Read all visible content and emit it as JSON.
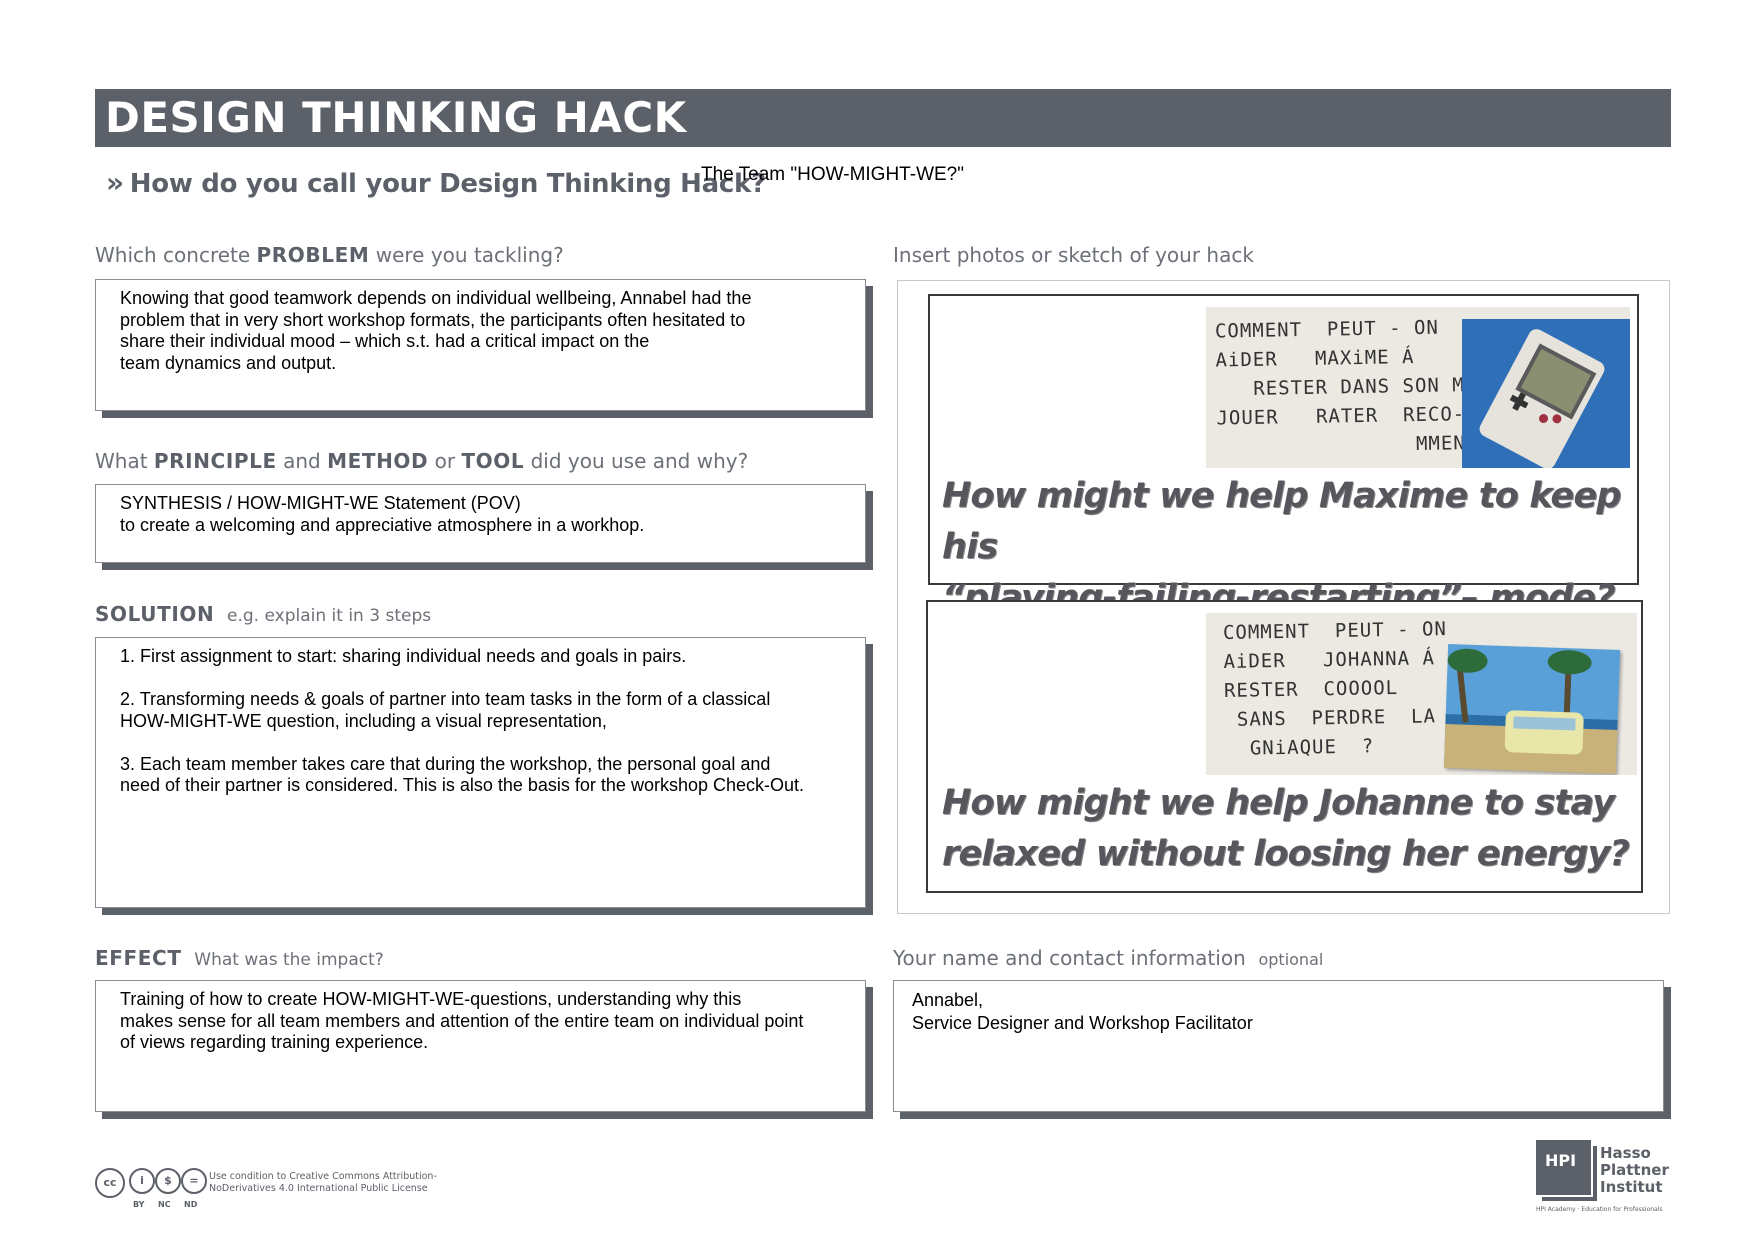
{
  "header": {
    "title": "DESIGN THINKING HACK",
    "hack_question": "How do you call your Design Thinking Hack?",
    "hack_answer": "The Team \"HOW-MIGHT-WE?\""
  },
  "problem": {
    "label_pre": "Which concrete ",
    "label_bold": "PROBLEM",
    "label_post": " were you tackling?",
    "text": "Knowing that good teamwork depends on individual wellbeing, Annabel had the\nproblem that in very short workshop formats, the participants often hesitated to\nshare their individual mood – which s.t. had a critical  impact on the\nteam dynamics and output."
  },
  "principle": {
    "label_pre": "What ",
    "label_b1": "PRINCIPLE",
    "label_and": " and ",
    "label_b2": "METHOD",
    "label_or": " or ",
    "label_b3": "TOOL",
    "label_post": " did you use and why?",
    "text": "SYNTHESIS / HOW-MIGHT-WE Statement (POV)\nto create a welcoming and appreciative atmosphere in a workhop."
  },
  "solution": {
    "label_bold": "SOLUTION",
    "label_post": "e.g. explain it in 3 steps",
    "text": "1. First assignment to start: sharing individual needs and goals in pairs.\n\n2. Transforming needs & goals of partner into team tasks in the form of a classical\nHOW-MIGHT-WE question,  including a visual representation,\n\n3. Each team member takes care that during the workshop, the personal goal and\nneed of their partner is considered. This is also the basis for the workshop Check-Out."
  },
  "effect": {
    "label_bold": "EFFECT",
    "label_post": "What was the impact?",
    "text": "Training of how to create HOW-MIGHT-WE-questions, understanding why this\nmakes sense for all team members and attention of the entire team on individual point\nof views regarding training experience."
  },
  "photos": {
    "label": "Insert photos or sketch of your hack",
    "card1": {
      "handwriting": "COMMENT  PEUT - ON\nAiDER   MAXiME Á\n   RESTER DANS SON MOOD\nJOUER   RATER  RECO-\n                MMENCER",
      "caption_line1": "How might we help Maxime to keep his",
      "caption_line2": "“playing-failing-restarting”– mode?"
    },
    "card2": {
      "handwriting": "COMMENT  PEUT - ON\nAiDER   JOHANNA Á\nRESTER  COOOOL\n SANS  PERDRE  LA\n  GNiAQUE  ?",
      "caption_line1": "How might we help Johanne to stay",
      "caption_line2": "relaxed without loosing her energy?"
    }
  },
  "contact": {
    "label": "Your name and contact information",
    "label_optional": "optional",
    "text": "Annabel,\nService Designer and Workshop Facilitator"
  },
  "footer": {
    "cc_icons": [
      "cc",
      "by",
      "nc",
      "nd"
    ],
    "cc_sub_by": "BY",
    "cc_sub_nc": "NC",
    "cc_sub_nd": "ND",
    "license_text": "Use condition to Creative Commons Attribution-\nNoDerivatives 4.0 International Public License",
    "hpi_abbr": "HPI",
    "hpi_name": "Hasso\nPlattner\nInstitut",
    "hpi_tagline": "HPI Academy · Education for Professionals"
  },
  "colors": {
    "banner": "#5c6068",
    "label_gray": "#6c7078",
    "photo_blue": "#2f6fb8"
  }
}
